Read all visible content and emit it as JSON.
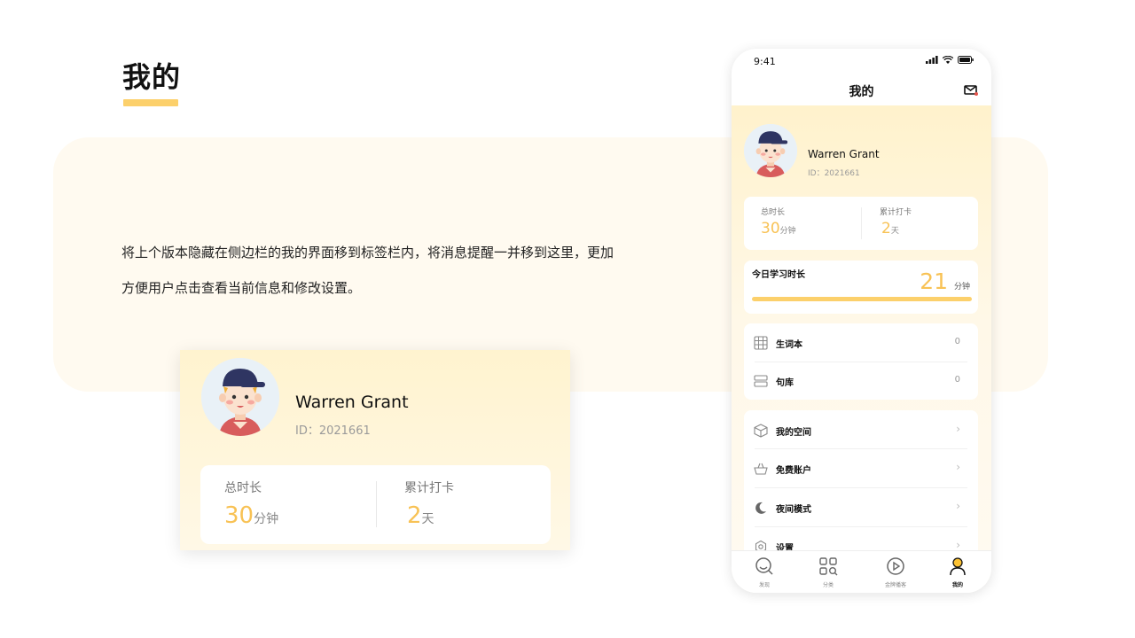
{
  "slide": {
    "title": "我的",
    "description_line1": "将上个版本隐藏在侧边栏的我的界面移到标签栏内，将消息提醒一并移到这里，更加",
    "description_line2": "方便用户点击查看当前信息和修改设置。"
  },
  "zoom_card": {
    "name": "Warren Grant",
    "id": "ID：2021661",
    "stats": [
      {
        "label": "总时长",
        "value": "30",
        "unit": "分钟"
      },
      {
        "label": "累计打卡",
        "value": "2",
        "unit": "天"
      }
    ]
  },
  "phone": {
    "status_time": "9:41",
    "nav_title": "我的",
    "profile": {
      "name": "Warren Grant",
      "id": "ID：2021661"
    },
    "stats": [
      {
        "label": "总时长",
        "value": "30",
        "unit": "分钟"
      },
      {
        "label": "累计打卡",
        "value": "2",
        "unit": "天"
      }
    ],
    "today": {
      "label": "今日学习时长",
      "value": "21",
      "unit": "分钟",
      "progress": 1.0
    },
    "vocab_list": [
      {
        "label": "生词本",
        "count": "0",
        "icon": "calendar-grid-icon"
      },
      {
        "label": "句库",
        "count": "0",
        "icon": "sentence-library-icon"
      }
    ],
    "menu": [
      {
        "label": "我的空间",
        "icon": "cube-icon"
      },
      {
        "label": "免费账户",
        "icon": "basket-icon"
      },
      {
        "label": "夜间模式",
        "icon": "moon-icon"
      },
      {
        "label": "设置",
        "icon": "gear-icon"
      }
    ],
    "tabs": [
      {
        "label": "发现",
        "icon": "discover-icon"
      },
      {
        "label": "分类",
        "icon": "category-icon"
      },
      {
        "label": "金牌播客",
        "icon": "play-icon"
      },
      {
        "label": "我的",
        "icon": "profile-icon",
        "active": true
      }
    ]
  },
  "colors": {
    "accent": "#fcd06b",
    "number": "#f8c255",
    "panel": "#fffaf0"
  }
}
